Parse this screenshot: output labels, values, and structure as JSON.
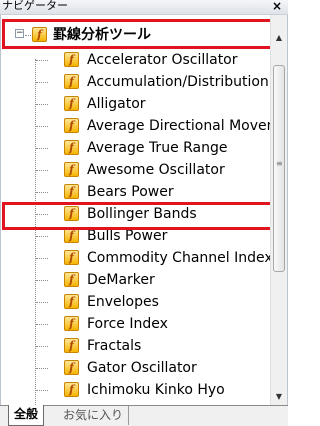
{
  "window": {
    "title": "ナビゲーター",
    "close_glyph": "×"
  },
  "tree": {
    "root": {
      "label": "罫線分析ツール",
      "expander_glyph": "−",
      "icon": "function-icon",
      "icon_glyph": "f"
    },
    "items": [
      {
        "label": "Accelerator Oscillator",
        "icon": "function-icon",
        "icon_glyph": "f"
      },
      {
        "label": "Accumulation/Distribution",
        "icon": "function-icon",
        "icon_glyph": "f"
      },
      {
        "label": "Alligator",
        "icon": "function-icon",
        "icon_glyph": "f"
      },
      {
        "label": "Average Directional Movement",
        "icon": "function-icon",
        "icon_glyph": "f"
      },
      {
        "label": "Average True Range",
        "icon": "function-icon",
        "icon_glyph": "f"
      },
      {
        "label": "Awesome Oscillator",
        "icon": "function-icon",
        "icon_glyph": "f"
      },
      {
        "label": "Bears Power",
        "icon": "function-icon",
        "icon_glyph": "f"
      },
      {
        "label": "Bollinger Bands",
        "icon": "function-icon",
        "icon_glyph": "f"
      },
      {
        "label": "Bulls Power",
        "icon": "function-icon",
        "icon_glyph": "f"
      },
      {
        "label": "Commodity Channel Index",
        "icon": "function-icon",
        "icon_glyph": "f"
      },
      {
        "label": "DeMarker",
        "icon": "function-icon",
        "icon_glyph": "f"
      },
      {
        "label": "Envelopes",
        "icon": "function-icon",
        "icon_glyph": "f"
      },
      {
        "label": "Force Index",
        "icon": "function-icon",
        "icon_glyph": "f"
      },
      {
        "label": "Fractals",
        "icon": "function-icon",
        "icon_glyph": "f"
      },
      {
        "label": "Gator Oscillator",
        "icon": "function-icon",
        "icon_glyph": "f"
      },
      {
        "label": "Ichimoku Kinko Hyo",
        "icon": "function-icon",
        "icon_glyph": "f"
      }
    ]
  },
  "highlights": [
    "罫線分析ツール",
    "Bollinger Bands"
  ],
  "scrollbar": {
    "up_glyph": "▲",
    "down_glyph": "▼",
    "grip_glyph": "≡"
  },
  "tabs": [
    {
      "label": "全般",
      "active": true
    },
    {
      "label": "お気に入り",
      "active": false
    }
  ],
  "colors": {
    "highlight": "#e0141e",
    "icon_fill": "#f5b400"
  }
}
